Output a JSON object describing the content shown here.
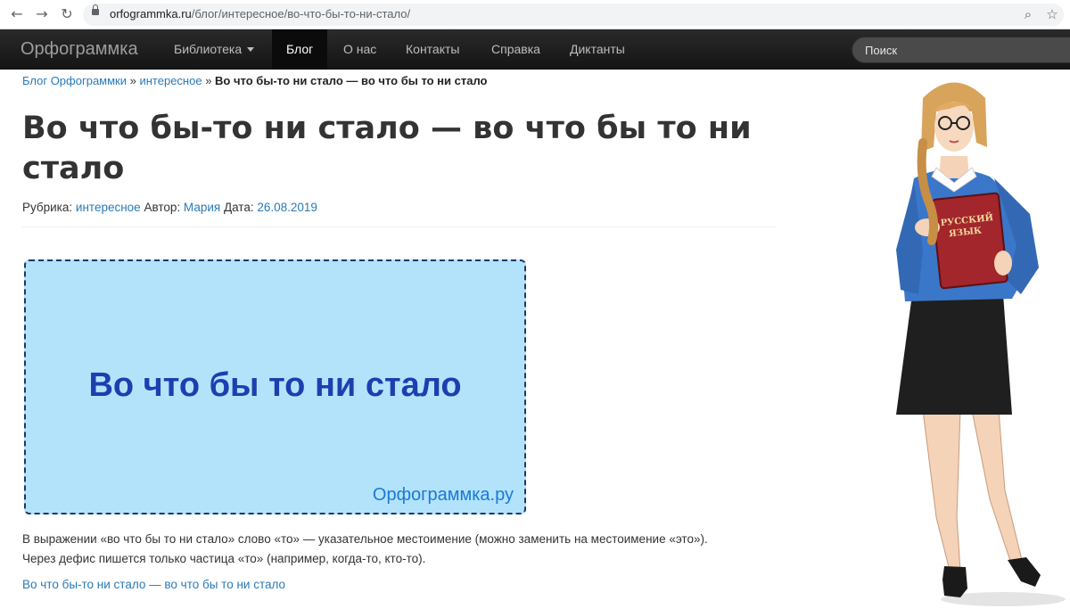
{
  "browser": {
    "domain": "orfogrammka.ru",
    "path": "/блог/интересное/во-что-бы-то-ни-стало/"
  },
  "site": {
    "brand": "Орфограммка",
    "nav": [
      {
        "label": "Библиотека",
        "dropdown": true
      },
      {
        "label": "Блог",
        "active": true
      },
      {
        "label": "О нас"
      },
      {
        "label": "Контакты"
      },
      {
        "label": "Справка"
      },
      {
        "label": "Диктанты"
      }
    ],
    "search_placeholder": "Поиск"
  },
  "breadcrumb": {
    "home": "Блог Орфограммки",
    "sep": "»",
    "category": "интересное",
    "current": "Во что бы-то ни стало — во что бы то ни стало"
  },
  "article": {
    "title": "Во что бы-то ни стало — во что бы то ни стало",
    "meta": {
      "rubric_label": "Рубрика:",
      "rubric": "интересное",
      "author_label": "Автор:",
      "author": "Мария",
      "date_label": "Дата:",
      "date": "26.08.2019"
    },
    "banner": {
      "text": "Во что бы то ни стало",
      "site": "Орфограммка.ру"
    },
    "paragraph_1": "В выражении «во что бы то ни стало» слово «то» — указательное местоимение (можно заменить на местоимение «это»).",
    "paragraph_2": "Через дефис пишется только частица «то» (например, когда-то, кто-то).",
    "link": "Во что бы-то ни стало — во что бы то ни стало"
  },
  "illustration": {
    "book_title_line1": "РУССКИЙ",
    "book_title_line2": "ЯЗЫК"
  },
  "colors": {
    "link": "#2a7ab8",
    "banner_bg": "#b3e3fb",
    "banner_text": "#1c3fb0",
    "navbar": "#1b1b1b"
  }
}
